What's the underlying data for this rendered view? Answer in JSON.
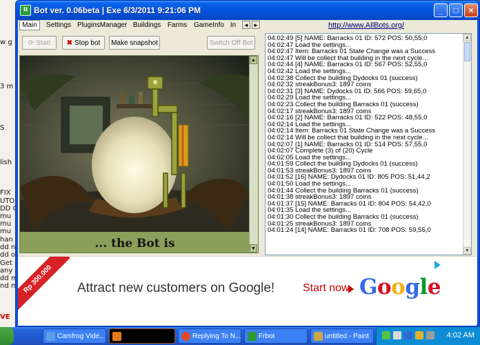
{
  "window": {
    "title": "Bot ver. 0.06beta | Exe 6/3/2011 9:21:06 PM",
    "minimize": "_",
    "maximize": "□",
    "close": "×"
  },
  "tabs": [
    "Main",
    "Settings",
    "PluginsManager",
    "Buildings",
    "Farms",
    "GameInfo",
    "In"
  ],
  "tab_scroll": {
    "left": "◄",
    "right": "►"
  },
  "url": "http://www.AllBots.org/",
  "toolbar": {
    "start": "Start",
    "stop": "Stop bot",
    "snapshot": "Make snapshot",
    "switch_off": "Switch Off Bot"
  },
  "image_caption": "... the Bot is",
  "log_lines": [
    "04:02:49 [5] NAME: Barracks 01 ID: 572 POS: 50,55,0",
    "04:02:47 Load the settings...",
    "04:02:47 Item: Barracks 01 State Change was a Success",
    "04:02:47 Will be collect that building in the next cycle...",
    "04:02:44 [4] NAME: Barracks 01 ID: 567 POS: 52,55,0",
    "04:02:42 Load the settings...",
    "04:02:38 Collect the building Dydocks 01 (success)",
    "04:02:32 streakBonus3: 1897 coins",
    "04:02:31 [3] NAME: Dydocks 01 ID: 566 POS: 59,65,0",
    "04:02:29 Load the settings...",
    "04:02:23 Collect the building Barracks 01 (success)",
    "04:02:17 streakBonus3: 1897 coins",
    "04:02:16 [2] NAME: Barracks 01 ID: 522 POS: 48,55,0",
    "04:02:14 Load the settings...",
    "04:02:14 Item: Barracks 01 State Change was a Success",
    "04:02:14 Will be collect that building in the next cycle...",
    "04:02:07 [1] NAME: Barracks 01 ID: 514 POS: 57,55,0",
    "04:02:07 Complete (3) of (20) Cycle",
    "04:02:05 Load the settings...",
    "04:01:59 Collect the building Dydocks 01 (success)",
    "04:01:53 streakBonus3: 1897 coins",
    "04:01:52 [16] NAME: Dydocks 01 ID: 805 POS: 51,44,2",
    "04:01:50 Load the settings...",
    "04:01:44 Collect the building Barracks 01 (success)",
    "04:01:38 streakBonus3: 1897 coins",
    "04:01:37 [15] NAME: Barracks 01 ID: 804 POS: 54,42,0",
    "04:01:35 Load the settings...",
    "04:01:30 Collect the building Barracks 01 (success)",
    "04:01:25 streakBonus3: 1897 coins",
    "04:01:24 [14] NAME: Barracks 01 ID: 708 POS: 59,55,0"
  ],
  "ad": {
    "ribbon": "Rp 300.000",
    "text": "Attract new customers on Google!",
    "cta": "Start now",
    "logo": "Google"
  },
  "bg_fragments": [
    "w g",
    "3 m",
    "S",
    "lish",
    "FIX",
    "UTO",
    "DD G",
    "mu",
    "mu",
    "mu",
    "han",
    "dd n",
    "dd o",
    "Get",
    "any",
    "dd m",
    "nd m",
    "VE"
  ],
  "taskbar": {
    "tasks": [
      "Camfrog Vide...",
      "",
      "Replying To N...",
      "Frbot",
      "untitled - Paint"
    ],
    "clock": "4:02 AM"
  },
  "colors": {
    "title_blue": "#0553dc",
    "image_green": "#8aa05a",
    "ad_red": "#d62127",
    "link": "#000080"
  }
}
